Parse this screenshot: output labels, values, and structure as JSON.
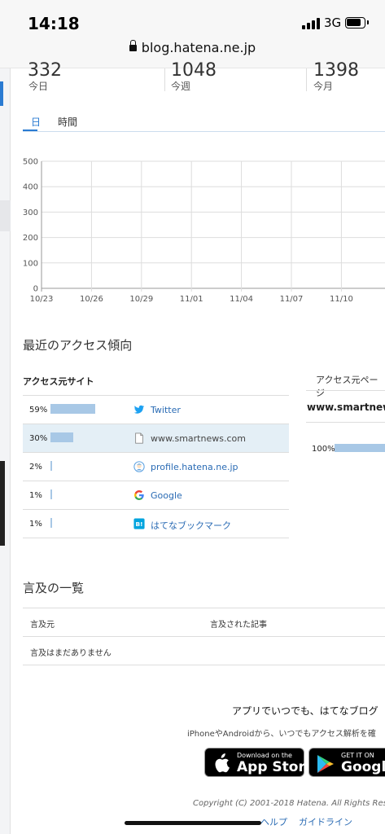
{
  "status": {
    "time": "14:18",
    "network": "3G",
    "url": "blog.hatena.ne.jp"
  },
  "summary": [
    {
      "value": "332",
      "label": "今日"
    },
    {
      "value": "1048",
      "label": "今週"
    },
    {
      "value": "1398",
      "label": "今月"
    }
  ],
  "tabs": [
    {
      "label": "日",
      "active": true
    },
    {
      "label": "時間",
      "active": false
    }
  ],
  "chart_data": {
    "type": "line",
    "categories": [
      "10/23",
      "10/26",
      "10/29",
      "11/01",
      "11/04",
      "11/07",
      "11/10"
    ],
    "ylim": [
      0,
      500
    ],
    "yticks": [
      "500",
      "400",
      "300",
      "200",
      "100",
      "0"
    ],
    "grid": true
  },
  "access": {
    "heading": "最近のアクセス傾向",
    "col_sites": "アクセス元サイト",
    "col_pages": "アクセス元ページ",
    "rows": [
      {
        "pct": "59%",
        "value": 59,
        "icon": "twitter-icon",
        "name": "Twitter",
        "link": true,
        "highlight": false
      },
      {
        "pct": "30%",
        "value": 30,
        "icon": "page-icon",
        "name": "www.smartnews.com",
        "link": false,
        "highlight": true
      },
      {
        "pct": "2%",
        "value": 2,
        "icon": "hatena-profile-icon",
        "name": "profile.hatena.ne.jp",
        "link": true,
        "highlight": false
      },
      {
        "pct": "1%",
        "value": 1,
        "icon": "google-icon",
        "name": "Google",
        "link": true,
        "highlight": false
      },
      {
        "pct": "1%",
        "value": 1,
        "icon": "hatena-bookmark-icon",
        "name": "はてなブックマーク",
        "link": true,
        "highlight": false
      }
    ],
    "page_url": "www.smartnews",
    "page_pct": "100%"
  },
  "mentions": {
    "heading": "言及の一覧",
    "col_source": "言及元",
    "col_article": "言及された記事",
    "empty": "言及はまだありません"
  },
  "promo": {
    "title": "アプリでいつでも、はてなブログ",
    "subtitle": "iPhoneやAndroidから、いつでもアクセス解析を確",
    "appstore_small": "Download on the",
    "appstore_big": "App Store",
    "gplay_small": "GET IT ON",
    "gplay_big": "Google P"
  },
  "footer": {
    "copyright": "Copyright (C) 2001-2018 Hatena. All Rights Res",
    "help": "ヘルプ",
    "guideline": "ガイドライン"
  }
}
